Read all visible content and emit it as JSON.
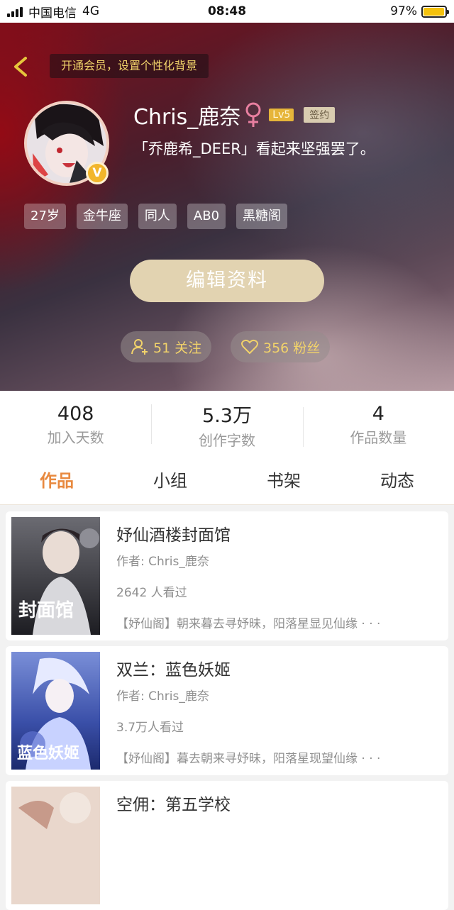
{
  "status_bar": {
    "carrier": "中国电信",
    "network": "4G",
    "time": "08:48",
    "battery": "97%",
    "battery_level": 0.97
  },
  "header": {
    "vip_banner": "开通会员，设置个性化背景"
  },
  "profile": {
    "username": "Chris_鹿奈",
    "level_badge": "Lv5",
    "signed_badge": "签约",
    "verify_badge": "V",
    "bio": "「乔鹿希_DEER」看起来坚强罢了。",
    "tags": [
      "27岁",
      "金牛座",
      "同人",
      "AB0",
      "黑糖阁"
    ],
    "edit_button": "编辑资料",
    "following": "51 关注",
    "followers": "356 粉丝"
  },
  "stats": [
    {
      "value": "408",
      "label": "加入天数"
    },
    {
      "value": "5.3万",
      "label": "创作字数"
    },
    {
      "value": "4",
      "label": "作品数量"
    }
  ],
  "tabs": [
    "作品",
    "小组",
    "书架",
    "动态"
  ],
  "active_tab": 0,
  "works": [
    {
      "title": "妤仙酒楼封面馆",
      "author": "作者: Chris_鹿奈",
      "views": "2642 人看过",
      "desc": "【妤仙阁】朝来暮去寻妤昧，阳落星显见仙缘 · · ·",
      "cover_text": "封面馆"
    },
    {
      "title": "双兰：蓝色妖姬",
      "author": "作者: Chris_鹿奈",
      "views": "3.7万人看过",
      "desc": "【妤仙阁】暮去朝来寻妤昧，阳落星现望仙缘 · · ·",
      "cover_text": "蓝色妖姬"
    },
    {
      "title": "空佣：第五学校",
      "author": "",
      "views": "",
      "desc": "",
      "cover_text": ""
    }
  ],
  "colors": {
    "accent": "#e8893f",
    "gold": "#f1d36a",
    "edit_button": "#e2d3b1",
    "female": "#e87fa0"
  }
}
